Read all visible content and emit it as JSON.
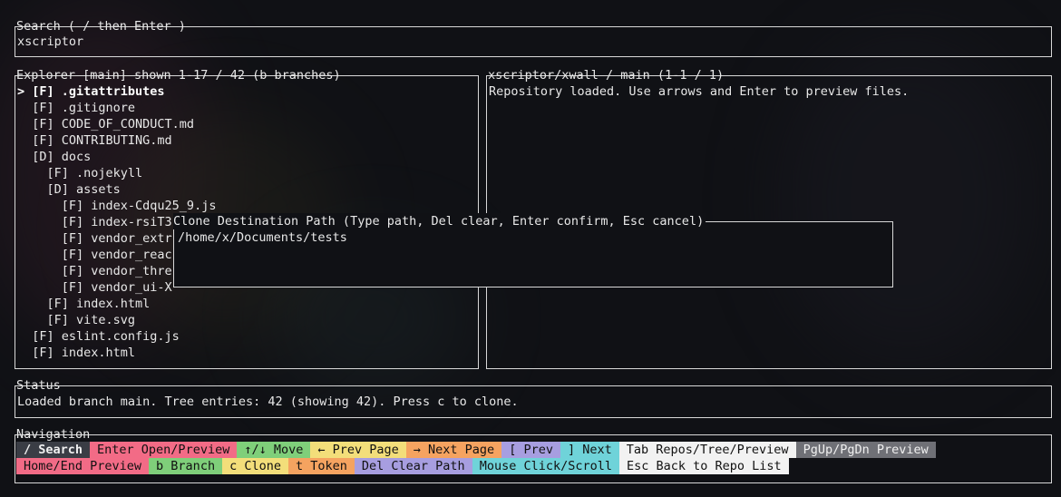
{
  "search": {
    "title": "Search ( / then Enter )",
    "value": "xscriptor"
  },
  "explorer": {
    "title": "Explorer [main] shown 1-17 / 42 (b branches)",
    "rows": [
      "> [F] .gitattributes",
      "  [F] .gitignore",
      "  [F] CODE_OF_CONDUCT.md",
      "  [F] CONTRIBUTING.md",
      "  [D] docs",
      "    [F] .nojekyll",
      "    [D] assets",
      "      [F] index-Cdqu25_9.js",
      "      [F] index-rsiT3",
      "      [F] vendor_extr",
      "      [F] vendor_reac",
      "      [F] vendor_thre",
      "      [F] vendor_ui-X",
      "    [F] index.html",
      "    [F] vite.svg",
      "  [F] eslint.config.js",
      "  [F] index.html"
    ]
  },
  "preview": {
    "title": "xscriptor/xwall / main (1-1 / 1)",
    "text": "Repository loaded. Use arrows and Enter to preview files."
  },
  "modal": {
    "title": "Clone Destination Path (Type path, Del clear, Enter confirm, Esc cancel)",
    "value": "/home/x/Documents/tests"
  },
  "status": {
    "title": "Status",
    "text": "Loaded branch main. Tree entries: 42 (showing 42). Press c to clone."
  },
  "navigation": {
    "title": "Navigation",
    "row1": [
      {
        "label": "/ Search",
        "color": "#3a3d45",
        "dark": true,
        "bold": true
      },
      {
        "label": "Enter Open/Preview",
        "color": "#f26b86",
        "dark": false
      },
      {
        "label": "↑/↓ Move",
        "color": "#7fcf7a",
        "dark": false
      },
      {
        "label": "← Prev Page",
        "color": "#f3de7a",
        "dark": false
      },
      {
        "label": "→ Next Page",
        "color": "#f5a360",
        "dark": false
      },
      {
        "label": "[ Prev",
        "color": "#a79ee0",
        "dark": false
      },
      {
        "label": "] Next",
        "color": "#6fd3d9",
        "dark": false
      },
      {
        "label": "Tab Repos/Tree/Preview",
        "color": "#f2f2f2",
        "dark": false
      },
      {
        "label": "PgUp/PgDn Preview",
        "color": "#6f7076",
        "dark": true
      }
    ],
    "row2": [
      {
        "label": "Home/End Preview",
        "color": "#f26b86",
        "dark": false
      },
      {
        "label": "b Branch",
        "color": "#7fcf7a",
        "dark": false
      },
      {
        "label": "c Clone",
        "color": "#f3de7a",
        "dark": false
      },
      {
        "label": "t Token",
        "color": "#f5a360",
        "dark": false
      },
      {
        "label": "Del Clear Path",
        "color": "#a79ee0",
        "dark": false
      },
      {
        "label": "Mouse Click/Scroll",
        "color": "#6fd3d9",
        "dark": false
      },
      {
        "label": "Esc Back to Repo List",
        "color": "#f2f2f2",
        "dark": false
      }
    ]
  }
}
